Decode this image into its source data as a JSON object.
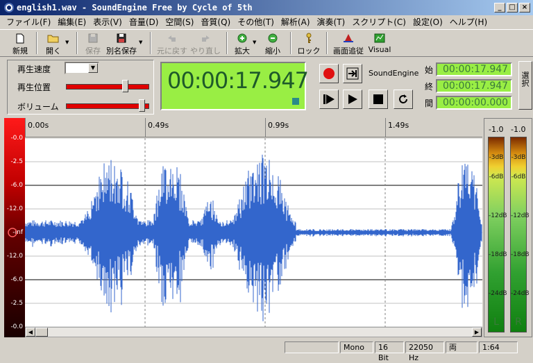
{
  "window": {
    "title": "english1.wav - SoundEngine Free by Cycle of 5th",
    "icon": "disc-icon",
    "buttons": [
      "_",
      "□",
      "×"
    ]
  },
  "menu": [
    "ファイル(F)",
    "編集(E)",
    "表示(V)",
    "音量(D)",
    "空間(S)",
    "音質(Q)",
    "その他(T)",
    "解析(A)",
    "演奏(T)",
    "スクリプト(C)",
    "設定(O)",
    "ヘルプ(H)"
  ],
  "toolbar": {
    "new": "新規",
    "open": "開く",
    "save": "保存",
    "save_as": "別名保存",
    "undo": "元に戻す",
    "redo": "やり直し",
    "zoom_in": "拡大",
    "zoom_out": "縮小",
    "lock": "ロック",
    "follow": "画面追従",
    "visual": "Visual"
  },
  "controls": {
    "speed_label": "再生速度",
    "position_label": "再生位置",
    "volume_label": "ボリューム",
    "position": 0.73,
    "volume": 0.95
  },
  "time_display": "00:00:17.947",
  "transport": {
    "engine_label": "SoundEngine"
  },
  "selection": {
    "start_label": "始",
    "start": "00:00:17.947",
    "end_label": "終",
    "end": "00:00:17.947",
    "length_label": "間",
    "length": "00:00:00.000"
  },
  "side_button": "選択",
  "ruler": [
    "0.00s",
    "0.49s",
    "0.99s",
    "1.49s"
  ],
  "scale_labels": [
    "-0.0",
    "-2.5",
    "-6.0",
    "-12.0",
    "-Inf",
    "-12.0",
    "-6.0",
    "-2.5",
    "-0.0"
  ],
  "meter": {
    "left_peak": "-1.0",
    "right_peak": "-1.0",
    "ticks": [
      "-3dB",
      "-6dB",
      "-12dB",
      "-18dB",
      "-24dB"
    ],
    "left_label": "L",
    "right_label": "R"
  },
  "status": {
    "mode": "Mono",
    "bits": "16 Bit",
    "rate": "22050 Hz",
    "channel": "両",
    "zoom": "1:64"
  },
  "colors": {
    "accent": "#99ee44",
    "wave": "#3366cc",
    "title": "#0a246a"
  }
}
